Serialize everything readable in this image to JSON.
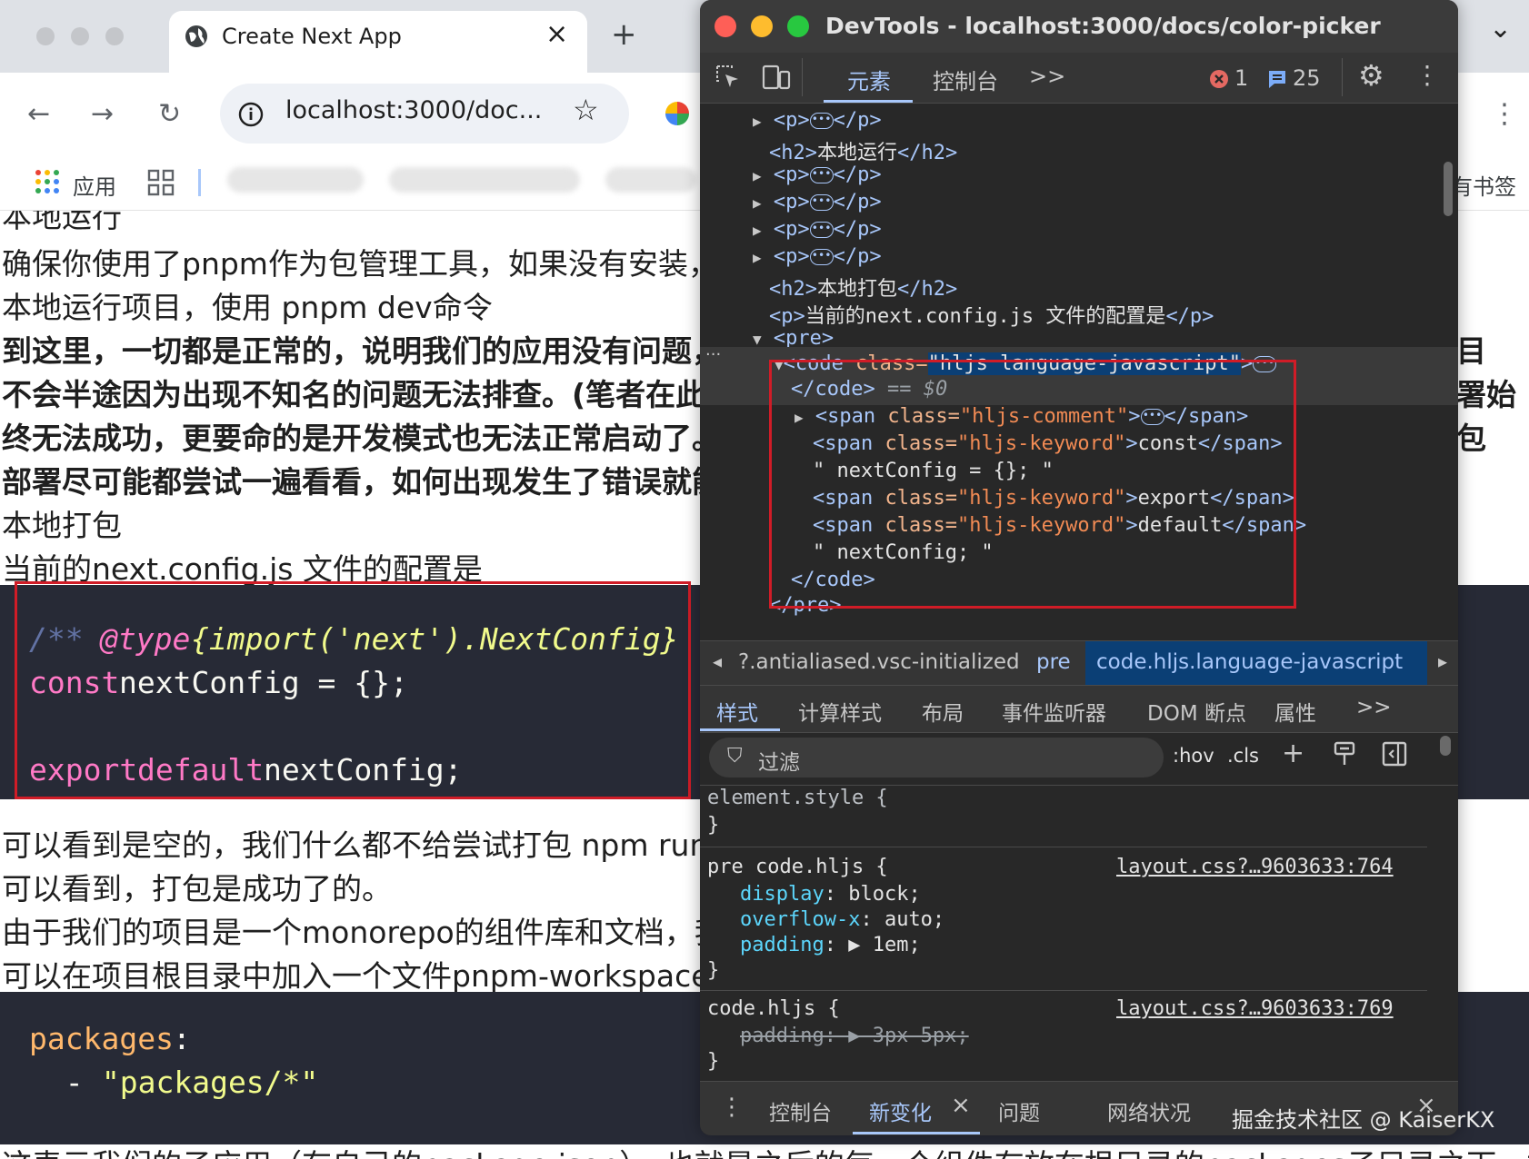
{
  "browser": {
    "tab_title": "Create Next App",
    "new_tab": "+",
    "close_tab": "×",
    "url": "localhost:3000/doc...",
    "apps_label": "应用",
    "bookmarks_partial": "有书签",
    "expand": "⌄"
  },
  "page": {
    "lines": [
      {
        "text": "确保你使用了pnpm作为包管理工具，如果没有安装，请"
      },
      {
        "text": "本地运行项目，使用 pnpm dev命令"
      },
      {
        "text": "到这里，一切都是正常的，说明我们的应用没有问题，"
      },
      {
        "text": "不会半途因为出现不知名的问题无法排查。(笔者在此之"
      },
      {
        "text": "终无法成功，更要命的是开发模式也无法正常启动了。"
      },
      {
        "text": "部署尽可能都尝试一遍看看，如何出现发生了错误就能"
      },
      {
        "text": "本地打包"
      },
      {
        "text": "当前的next.config.js 文件的配置是"
      }
    ],
    "right_fragments": [
      "目",
      "署始",
      "包"
    ],
    "code1": {
      "comment_start": "/** ",
      "comment_tag": "@type",
      "comment_type": " {import('next').NextConfig}",
      "kw_const": "const",
      "line1_rest": " nextConfig = {};",
      "kw_export": "export",
      "kw_default": " default",
      "line3_rest": " nextConfig;"
    },
    "lines2": [
      {
        "text": "可以看到是空的，我们什么都不给尝试打包 npm  run"
      },
      {
        "text": "可以看到，打包是成功了的。"
      },
      {
        "text": "由于我们的项目是一个monorepo的组件库和文档，我们"
      },
      {
        "text": "可以在项目根目录中加入一个文件pnpm-workspace."
      }
    ],
    "code2": {
      "key": "packages",
      "colon": ":",
      "dash": "  -",
      "value": " \"packages/*\""
    },
    "bottom_line": "这表示我们的子应用（有自己的package.json），也就是之后的每一个组件存放在根目录的packages子目录之下，加"
  },
  "devtools": {
    "title": "DevTools - localhost:3000/docs/color-picker",
    "tabs": [
      "元素",
      "控制台"
    ],
    "more_tabs": ">>",
    "error_count": "1",
    "message_count": "25",
    "tree": {
      "p_open": "<p>",
      "p_close": "</p>",
      "h2_run_open": "<h2>",
      "h2_run_text": "本地运行",
      "h2_close": "</h2>",
      "h2_pack_text": "本地打包",
      "p_config_text": "当前的next.config.js 文件的配置是",
      "pre_open": "<pre>",
      "code_tag": "<code",
      "code_attr_name": " class=",
      "code_attr_value": "\"hljs language-javascript\"",
      "code_gt": ">",
      "code_close": "</code>",
      "dollar": " == $0",
      "span_open": "<span",
      "span_class": " class=",
      "cls_comment": "\"hljs-comment\"",
      "cls_keyword": "\"hljs-keyword\"",
      "span_close": "</span>",
      "kw_const": "const",
      "kw_export": "export",
      "kw_default": "default",
      "text1": "\" nextConfig = {}; \"",
      "text2": "\" nextConfig; \"",
      "code_end": "</code>",
      "pre_end": "</pre>"
    },
    "breadcrumbs": [
      "?.antialiased.vsc-initialized",
      "pre",
      "code.hljs.language-javascript"
    ],
    "sub_tabs": [
      "样式",
      "计算样式",
      "布局",
      "事件监听器",
      "DOM 断点",
      "属性"
    ],
    "filter_placeholder": "过滤",
    "hov": ":hov",
    "cls": ".cls",
    "rules": {
      "element_style": "element.style {",
      "close": "}",
      "rule1_selector": "pre code.hljs {",
      "rule1_source": "layout.css?…9603633:764",
      "rule1_props": [
        {
          "name": "display",
          "value": " block;"
        },
        {
          "name": "overflow-x",
          "value": " auto;"
        },
        {
          "name": "padding",
          "value": " ▶ 1em;"
        }
      ],
      "rule2_selector": "code.hljs {",
      "rule2_source": "layout.css?…9603633:769",
      "rule2_prop": "padding: ▶ 3px 5px;"
    },
    "drawer_tabs": [
      "控制台",
      "新变化",
      "问题",
      "网络状况"
    ],
    "drawer_close": "×"
  },
  "watermark": "掘金技术社区 @ KaiserKX",
  "colors": {
    "highlight_red": "#d01c27",
    "code_bg": "#272a36",
    "devtools_bg": "#282828",
    "accent_blue": "#7cacf8"
  }
}
